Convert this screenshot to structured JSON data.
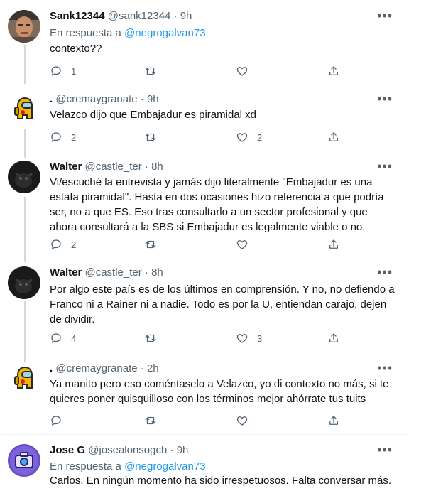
{
  "tweets": [
    {
      "name": "Sank12344",
      "handle": "@sank12344",
      "sep": "·",
      "time": "9h",
      "reply_prefix": "En respuesta a",
      "reply_to": "@negrogalvan73",
      "text": "contexto??",
      "replies": "1",
      "retweets": "",
      "likes": ""
    },
    {
      "name": ".",
      "handle": "@cremaygranate",
      "sep": "·",
      "time": "9h",
      "text": "Velazco dijo que Embajadur es piramidal xd",
      "replies": "2",
      "retweets": "",
      "likes": "2"
    },
    {
      "name": "Walter",
      "handle": "@castle_ter",
      "sep": "·",
      "time": "8h",
      "text": "Vi/escuché la entrevista y jamás dijo literalmente \"Embajadur es una estafa piramidal\". Hasta en dos ocasiones hizo referencia a que podría ser, no a que ES. Eso tras consultarlo a un sector profesional y que ahora consultará a la SBS si Embajadur es legalmente viable o no.",
      "replies": "2",
      "retweets": "",
      "likes": ""
    },
    {
      "name": "Walter",
      "handle": "@castle_ter",
      "sep": "·",
      "time": "8h",
      "text": "Por algo este país es de los últimos en comprensión. Y no, no defiendo a Franco ni a Rainer ni a nadie. Todo es por la U, entiendan carajo, dejen de dividir.",
      "replies": "4",
      "retweets": "",
      "likes": "3"
    },
    {
      "name": ".",
      "handle": "@cremaygranate",
      "sep": "·",
      "time": "2h",
      "text": "Ya manito pero eso coméntaselo a Velazco, yo di contexto no más, si te quieres poner quisquilloso con los términos mejor ahórrate tus tuits",
      "replies": "",
      "retweets": "",
      "likes": ""
    },
    {
      "name": "Jose G",
      "handle": "@josealonsogch",
      "sep": "·",
      "time": "9h",
      "reply_prefix": "En respuesta a",
      "reply_to": "@negrogalvan73",
      "text": "Carlos. En ningún momento ha sido irrespetuosos. Falta conversar más.",
      "replies": "",
      "retweets": "",
      "likes": ""
    }
  ],
  "colors": {
    "accent": "#1d9bf0",
    "muted": "#536471",
    "thread_line": "#cfd9de"
  },
  "icons": [
    "reply-icon",
    "retweet-icon",
    "like-icon",
    "share-icon",
    "more-icon"
  ]
}
